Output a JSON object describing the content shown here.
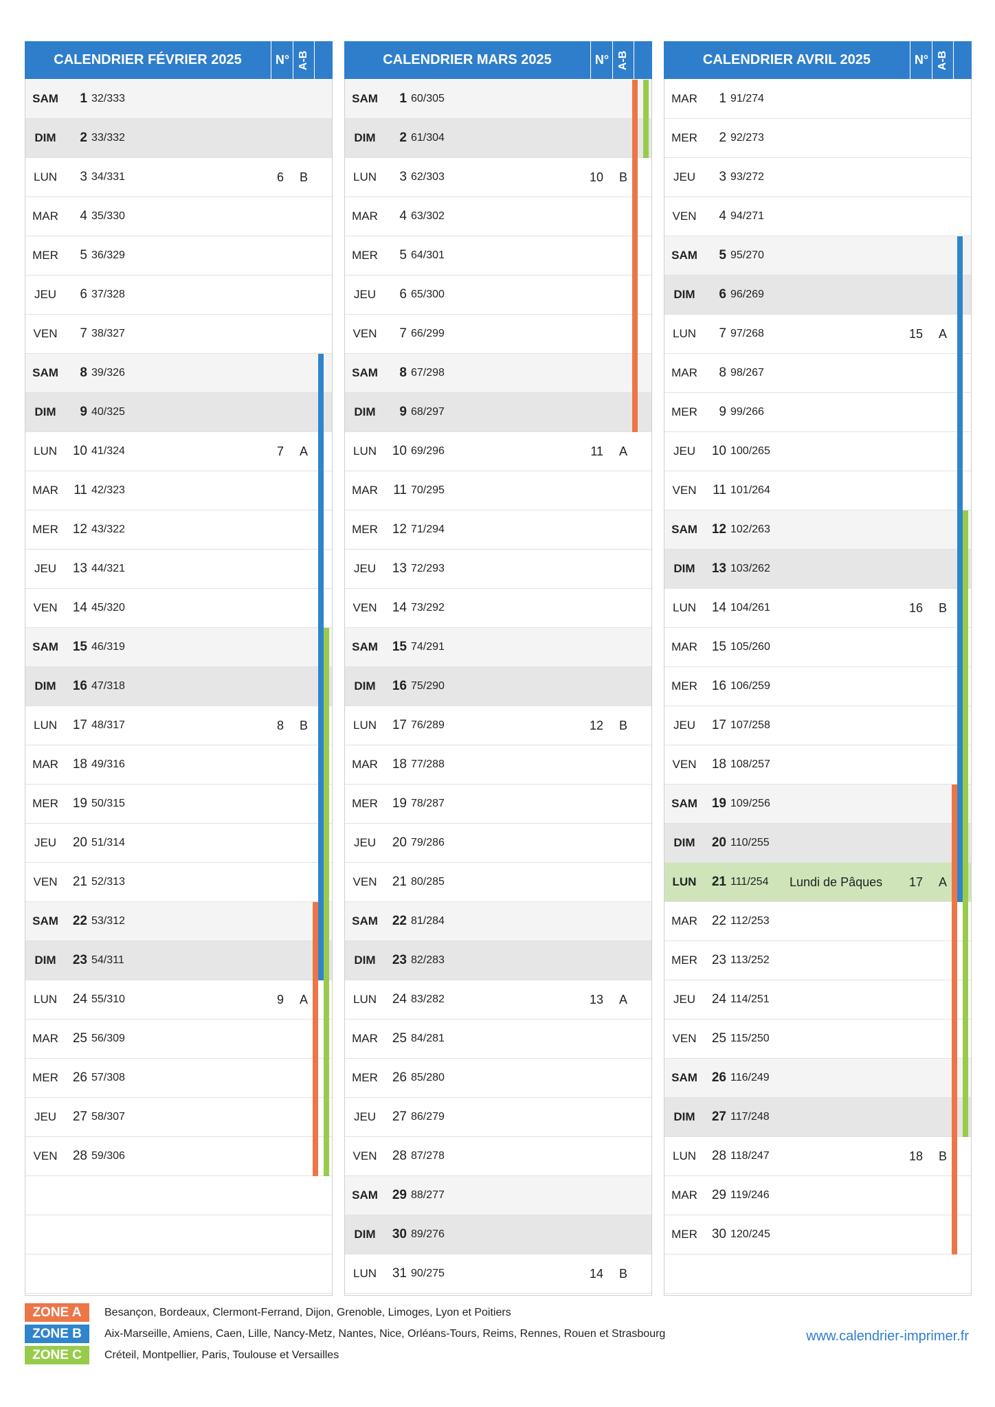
{
  "months": [
    {
      "title": "CALENDRIER FÉVRIER 2025",
      "no_label": "N°",
      "ab_label": "A-B",
      "days": [
        {
          "name": "SAM",
          "num": "1",
          "count": "32/333",
          "kind": "sat",
          "wn": "",
          "wab": "",
          "hol": "",
          "zones": ""
        },
        {
          "name": "DIM",
          "num": "2",
          "count": "33/332",
          "kind": "sun",
          "wn": "",
          "wab": "",
          "hol": "",
          "zones": ""
        },
        {
          "name": "LUN",
          "num": "3",
          "count": "34/331",
          "kind": "",
          "wn": "6",
          "wab": "B",
          "hol": "",
          "zones": ""
        },
        {
          "name": "MAR",
          "num": "4",
          "count": "35/330",
          "kind": "",
          "wn": "",
          "wab": "",
          "hol": "",
          "zones": ""
        },
        {
          "name": "MER",
          "num": "5",
          "count": "36/329",
          "kind": "",
          "wn": "",
          "wab": "",
          "hol": "",
          "zones": ""
        },
        {
          "name": "JEU",
          "num": "6",
          "count": "37/328",
          "kind": "",
          "wn": "",
          "wab": "",
          "hol": "",
          "zones": ""
        },
        {
          "name": "VEN",
          "num": "7",
          "count": "38/327",
          "kind": "",
          "wn": "",
          "wab": "",
          "hol": "",
          "zones": ""
        },
        {
          "name": "SAM",
          "num": "8",
          "count": "39/326",
          "kind": "sat",
          "wn": "",
          "wab": "",
          "hol": "",
          "zones": "B"
        },
        {
          "name": "DIM",
          "num": "9",
          "count": "40/325",
          "kind": "sun",
          "wn": "",
          "wab": "",
          "hol": "",
          "zones": "B"
        },
        {
          "name": "LUN",
          "num": "10",
          "count": "41/324",
          "kind": "",
          "wn": "7",
          "wab": "A",
          "hol": "",
          "zones": "B"
        },
        {
          "name": "MAR",
          "num": "11",
          "count": "42/323",
          "kind": "",
          "wn": "",
          "wab": "",
          "hol": "",
          "zones": "B"
        },
        {
          "name": "MER",
          "num": "12",
          "count": "43/322",
          "kind": "",
          "wn": "",
          "wab": "",
          "hol": "",
          "zones": "B"
        },
        {
          "name": "JEU",
          "num": "13",
          "count": "44/321",
          "kind": "",
          "wn": "",
          "wab": "",
          "hol": "",
          "zones": "B"
        },
        {
          "name": "VEN",
          "num": "14",
          "count": "45/320",
          "kind": "",
          "wn": "",
          "wab": "",
          "hol": "",
          "zones": "B"
        },
        {
          "name": "SAM",
          "num": "15",
          "count": "46/319",
          "kind": "sat",
          "wn": "",
          "wab": "",
          "hol": "",
          "zones": "BC"
        },
        {
          "name": "DIM",
          "num": "16",
          "count": "47/318",
          "kind": "sun",
          "wn": "",
          "wab": "",
          "hol": "",
          "zones": "BC"
        },
        {
          "name": "LUN",
          "num": "17",
          "count": "48/317",
          "kind": "",
          "wn": "8",
          "wab": "B",
          "hol": "",
          "zones": "BC"
        },
        {
          "name": "MAR",
          "num": "18",
          "count": "49/316",
          "kind": "",
          "wn": "",
          "wab": "",
          "hol": "",
          "zones": "BC"
        },
        {
          "name": "MER",
          "num": "19",
          "count": "50/315",
          "kind": "",
          "wn": "",
          "wab": "",
          "hol": "",
          "zones": "BC"
        },
        {
          "name": "JEU",
          "num": "20",
          "count": "51/314",
          "kind": "",
          "wn": "",
          "wab": "",
          "hol": "",
          "zones": "BC"
        },
        {
          "name": "VEN",
          "num": "21",
          "count": "52/313",
          "kind": "",
          "wn": "",
          "wab": "",
          "hol": "",
          "zones": "BC"
        },
        {
          "name": "SAM",
          "num": "22",
          "count": "53/312",
          "kind": "sat",
          "wn": "",
          "wab": "",
          "hol": "",
          "zones": "ABC"
        },
        {
          "name": "DIM",
          "num": "23",
          "count": "54/311",
          "kind": "sun",
          "wn": "",
          "wab": "",
          "hol": "",
          "zones": "ABC"
        },
        {
          "name": "LUN",
          "num": "24",
          "count": "55/310",
          "kind": "",
          "wn": "9",
          "wab": "A",
          "hol": "",
          "zones": "AC"
        },
        {
          "name": "MAR",
          "num": "25",
          "count": "56/309",
          "kind": "",
          "wn": "",
          "wab": "",
          "hol": "",
          "zones": "AC"
        },
        {
          "name": "MER",
          "num": "26",
          "count": "57/308",
          "kind": "",
          "wn": "",
          "wab": "",
          "hol": "",
          "zones": "AC"
        },
        {
          "name": "JEU",
          "num": "27",
          "count": "58/307",
          "kind": "",
          "wn": "",
          "wab": "",
          "hol": "",
          "zones": "AC"
        },
        {
          "name": "VEN",
          "num": "28",
          "count": "59/306",
          "kind": "",
          "wn": "",
          "wab": "",
          "hol": "",
          "zones": "AC"
        }
      ]
    },
    {
      "title": "CALENDRIER MARS 2025",
      "no_label": "N°",
      "ab_label": "A-B",
      "days": [
        {
          "name": "SAM",
          "num": "1",
          "count": "60/305",
          "kind": "sat",
          "wn": "",
          "wab": "",
          "hol": "",
          "zones": "AC"
        },
        {
          "name": "DIM",
          "num": "2",
          "count": "61/304",
          "kind": "sun",
          "wn": "",
          "wab": "",
          "hol": "",
          "zones": "AC"
        },
        {
          "name": "LUN",
          "num": "3",
          "count": "62/303",
          "kind": "",
          "wn": "10",
          "wab": "B",
          "hol": "",
          "zones": "A"
        },
        {
          "name": "MAR",
          "num": "4",
          "count": "63/302",
          "kind": "",
          "wn": "",
          "wab": "",
          "hol": "",
          "zones": "A"
        },
        {
          "name": "MER",
          "num": "5",
          "count": "64/301",
          "kind": "",
          "wn": "",
          "wab": "",
          "hol": "",
          "zones": "A"
        },
        {
          "name": "JEU",
          "num": "6",
          "count": "65/300",
          "kind": "",
          "wn": "",
          "wab": "",
          "hol": "",
          "zones": "A"
        },
        {
          "name": "VEN",
          "num": "7",
          "count": "66/299",
          "kind": "",
          "wn": "",
          "wab": "",
          "hol": "",
          "zones": "A"
        },
        {
          "name": "SAM",
          "num": "8",
          "count": "67/298",
          "kind": "sat",
          "wn": "",
          "wab": "",
          "hol": "",
          "zones": "A"
        },
        {
          "name": "DIM",
          "num": "9",
          "count": "68/297",
          "kind": "sun",
          "wn": "",
          "wab": "",
          "hol": "",
          "zones": "A"
        },
        {
          "name": "LUN",
          "num": "10",
          "count": "69/296",
          "kind": "",
          "wn": "11",
          "wab": "A",
          "hol": "",
          "zones": ""
        },
        {
          "name": "MAR",
          "num": "11",
          "count": "70/295",
          "kind": "",
          "wn": "",
          "wab": "",
          "hol": "",
          "zones": ""
        },
        {
          "name": "MER",
          "num": "12",
          "count": "71/294",
          "kind": "",
          "wn": "",
          "wab": "",
          "hol": "",
          "zones": ""
        },
        {
          "name": "JEU",
          "num": "13",
          "count": "72/293",
          "kind": "",
          "wn": "",
          "wab": "",
          "hol": "",
          "zones": ""
        },
        {
          "name": "VEN",
          "num": "14",
          "count": "73/292",
          "kind": "",
          "wn": "",
          "wab": "",
          "hol": "",
          "zones": ""
        },
        {
          "name": "SAM",
          "num": "15",
          "count": "74/291",
          "kind": "sat",
          "wn": "",
          "wab": "",
          "hol": "",
          "zones": ""
        },
        {
          "name": "DIM",
          "num": "16",
          "count": "75/290",
          "kind": "sun",
          "wn": "",
          "wab": "",
          "hol": "",
          "zones": ""
        },
        {
          "name": "LUN",
          "num": "17",
          "count": "76/289",
          "kind": "",
          "wn": "12",
          "wab": "B",
          "hol": "",
          "zones": ""
        },
        {
          "name": "MAR",
          "num": "18",
          "count": "77/288",
          "kind": "",
          "wn": "",
          "wab": "",
          "hol": "",
          "zones": ""
        },
        {
          "name": "MER",
          "num": "19",
          "count": "78/287",
          "kind": "",
          "wn": "",
          "wab": "",
          "hol": "",
          "zones": ""
        },
        {
          "name": "JEU",
          "num": "20",
          "count": "79/286",
          "kind": "",
          "wn": "",
          "wab": "",
          "hol": "",
          "zones": ""
        },
        {
          "name": "VEN",
          "num": "21",
          "count": "80/285",
          "kind": "",
          "wn": "",
          "wab": "",
          "hol": "",
          "zones": ""
        },
        {
          "name": "SAM",
          "num": "22",
          "count": "81/284",
          "kind": "sat",
          "wn": "",
          "wab": "",
          "hol": "",
          "zones": ""
        },
        {
          "name": "DIM",
          "num": "23",
          "count": "82/283",
          "kind": "sun",
          "wn": "",
          "wab": "",
          "hol": "",
          "zones": ""
        },
        {
          "name": "LUN",
          "num": "24",
          "count": "83/282",
          "kind": "",
          "wn": "13",
          "wab": "A",
          "hol": "",
          "zones": ""
        },
        {
          "name": "MAR",
          "num": "25",
          "count": "84/281",
          "kind": "",
          "wn": "",
          "wab": "",
          "hol": "",
          "zones": ""
        },
        {
          "name": "MER",
          "num": "26",
          "count": "85/280",
          "kind": "",
          "wn": "",
          "wab": "",
          "hol": "",
          "zones": ""
        },
        {
          "name": "JEU",
          "num": "27",
          "count": "86/279",
          "kind": "",
          "wn": "",
          "wab": "",
          "hol": "",
          "zones": ""
        },
        {
          "name": "VEN",
          "num": "28",
          "count": "87/278",
          "kind": "",
          "wn": "",
          "wab": "",
          "hol": "",
          "zones": ""
        },
        {
          "name": "SAM",
          "num": "29",
          "count": "88/277",
          "kind": "sat",
          "wn": "",
          "wab": "",
          "hol": "",
          "zones": ""
        },
        {
          "name": "DIM",
          "num": "30",
          "count": "89/276",
          "kind": "sun",
          "wn": "",
          "wab": "",
          "hol": "",
          "zones": ""
        },
        {
          "name": "LUN",
          "num": "31",
          "count": "90/275",
          "kind": "",
          "wn": "14",
          "wab": "B",
          "hol": "",
          "zones": ""
        }
      ]
    },
    {
      "title": "CALENDRIER AVRIL 2025",
      "no_label": "N°",
      "ab_label": "A-B",
      "days": [
        {
          "name": "MAR",
          "num": "1",
          "count": "91/274",
          "kind": "",
          "wn": "",
          "wab": "",
          "hol": "",
          "zones": ""
        },
        {
          "name": "MER",
          "num": "2",
          "count": "92/273",
          "kind": "",
          "wn": "",
          "wab": "",
          "hol": "",
          "zones": ""
        },
        {
          "name": "JEU",
          "num": "3",
          "count": "93/272",
          "kind": "",
          "wn": "",
          "wab": "",
          "hol": "",
          "zones": ""
        },
        {
          "name": "VEN",
          "num": "4",
          "count": "94/271",
          "kind": "",
          "wn": "",
          "wab": "",
          "hol": "",
          "zones": ""
        },
        {
          "name": "SAM",
          "num": "5",
          "count": "95/270",
          "kind": "sat",
          "wn": "",
          "wab": "",
          "hol": "",
          "zones": "B"
        },
        {
          "name": "DIM",
          "num": "6",
          "count": "96/269",
          "kind": "sun",
          "wn": "",
          "wab": "",
          "hol": "",
          "zones": "B"
        },
        {
          "name": "LUN",
          "num": "7",
          "count": "97/268",
          "kind": "",
          "wn": "15",
          "wab": "A",
          "hol": "",
          "zones": "B"
        },
        {
          "name": "MAR",
          "num": "8",
          "count": "98/267",
          "kind": "",
          "wn": "",
          "wab": "",
          "hol": "",
          "zones": "B"
        },
        {
          "name": "MER",
          "num": "9",
          "count": "99/266",
          "kind": "",
          "wn": "",
          "wab": "",
          "hol": "",
          "zones": "B"
        },
        {
          "name": "JEU",
          "num": "10",
          "count": "100/265",
          "kind": "",
          "wn": "",
          "wab": "",
          "hol": "",
          "zones": "B"
        },
        {
          "name": "VEN",
          "num": "11",
          "count": "101/264",
          "kind": "",
          "wn": "",
          "wab": "",
          "hol": "",
          "zones": "B"
        },
        {
          "name": "SAM",
          "num": "12",
          "count": "102/263",
          "kind": "sat",
          "wn": "",
          "wab": "",
          "hol": "",
          "zones": "BC"
        },
        {
          "name": "DIM",
          "num": "13",
          "count": "103/262",
          "kind": "sun",
          "wn": "",
          "wab": "",
          "hol": "",
          "zones": "BC"
        },
        {
          "name": "LUN",
          "num": "14",
          "count": "104/261",
          "kind": "",
          "wn": "16",
          "wab": "B",
          "hol": "",
          "zones": "BC"
        },
        {
          "name": "MAR",
          "num": "15",
          "count": "105/260",
          "kind": "",
          "wn": "",
          "wab": "",
          "hol": "",
          "zones": "BC"
        },
        {
          "name": "MER",
          "num": "16",
          "count": "106/259",
          "kind": "",
          "wn": "",
          "wab": "",
          "hol": "",
          "zones": "BC"
        },
        {
          "name": "JEU",
          "num": "17",
          "count": "107/258",
          "kind": "",
          "wn": "",
          "wab": "",
          "hol": "",
          "zones": "BC"
        },
        {
          "name": "VEN",
          "num": "18",
          "count": "108/257",
          "kind": "",
          "wn": "",
          "wab": "",
          "hol": "",
          "zones": "BC"
        },
        {
          "name": "SAM",
          "num": "19",
          "count": "109/256",
          "kind": "sat",
          "wn": "",
          "wab": "",
          "hol": "",
          "zones": "ABC"
        },
        {
          "name": "DIM",
          "num": "20",
          "count": "110/255",
          "kind": "sun",
          "wn": "",
          "wab": "",
          "hol": "",
          "zones": "ABC"
        },
        {
          "name": "LUN",
          "num": "21",
          "count": "111/254",
          "kind": "holiday",
          "wn": "17",
          "wab": "A",
          "hol": "Lundi de Pâques",
          "zones": "ABC"
        },
        {
          "name": "MAR",
          "num": "22",
          "count": "112/253",
          "kind": "",
          "wn": "",
          "wab": "",
          "hol": "",
          "zones": "AC"
        },
        {
          "name": "MER",
          "num": "23",
          "count": "113/252",
          "kind": "",
          "wn": "",
          "wab": "",
          "hol": "",
          "zones": "AC"
        },
        {
          "name": "JEU",
          "num": "24",
          "count": "114/251",
          "kind": "",
          "wn": "",
          "wab": "",
          "hol": "",
          "zones": "AC"
        },
        {
          "name": "VEN",
          "num": "25",
          "count": "115/250",
          "kind": "",
          "wn": "",
          "wab": "",
          "hol": "",
          "zones": "AC"
        },
        {
          "name": "SAM",
          "num": "26",
          "count": "116/249",
          "kind": "sat",
          "wn": "",
          "wab": "",
          "hol": "",
          "zones": "AC"
        },
        {
          "name": "DIM",
          "num": "27",
          "count": "117/248",
          "kind": "sun",
          "wn": "",
          "wab": "",
          "hol": "",
          "zones": "AC"
        },
        {
          "name": "LUN",
          "num": "28",
          "count": "118/247",
          "kind": "",
          "wn": "18",
          "wab": "B",
          "hol": "",
          "zones": "A"
        },
        {
          "name": "MAR",
          "num": "29",
          "count": "119/246",
          "kind": "",
          "wn": "",
          "wab": "",
          "hol": "",
          "zones": "A"
        },
        {
          "name": "MER",
          "num": "30",
          "count": "120/245",
          "kind": "",
          "wn": "",
          "wab": "",
          "hol": "",
          "zones": "A"
        }
      ]
    }
  ],
  "legend": [
    {
      "zone": "A",
      "label": "ZONE A",
      "text": "Besançon, Bordeaux, Clermont-Ferrand, Dijon, Grenoble, Limoges, Lyon et Poitiers",
      "color": "#ec7648"
    },
    {
      "zone": "B",
      "label": "ZONE B",
      "text": "Aix-Marseille, Amiens, Caen, Lille, Nancy-Metz, Nantes, Nice, Orléans-Tours, Reims, Rennes, Rouen et Strasbourg",
      "color": "#2f84cc"
    },
    {
      "zone": "C",
      "label": "ZONE C",
      "text": "Créteil, Montpellier, Paris, Toulouse et Versailles",
      "color": "#98cb4c"
    }
  ],
  "website": "www.calendrier-imprimer.fr",
  "colors": {
    "header": "#2f7ecb",
    "zoneA": "#ec7648",
    "zoneB": "#2f84cc",
    "zoneC": "#98cb4c",
    "holiday": "#cfe5b9"
  }
}
